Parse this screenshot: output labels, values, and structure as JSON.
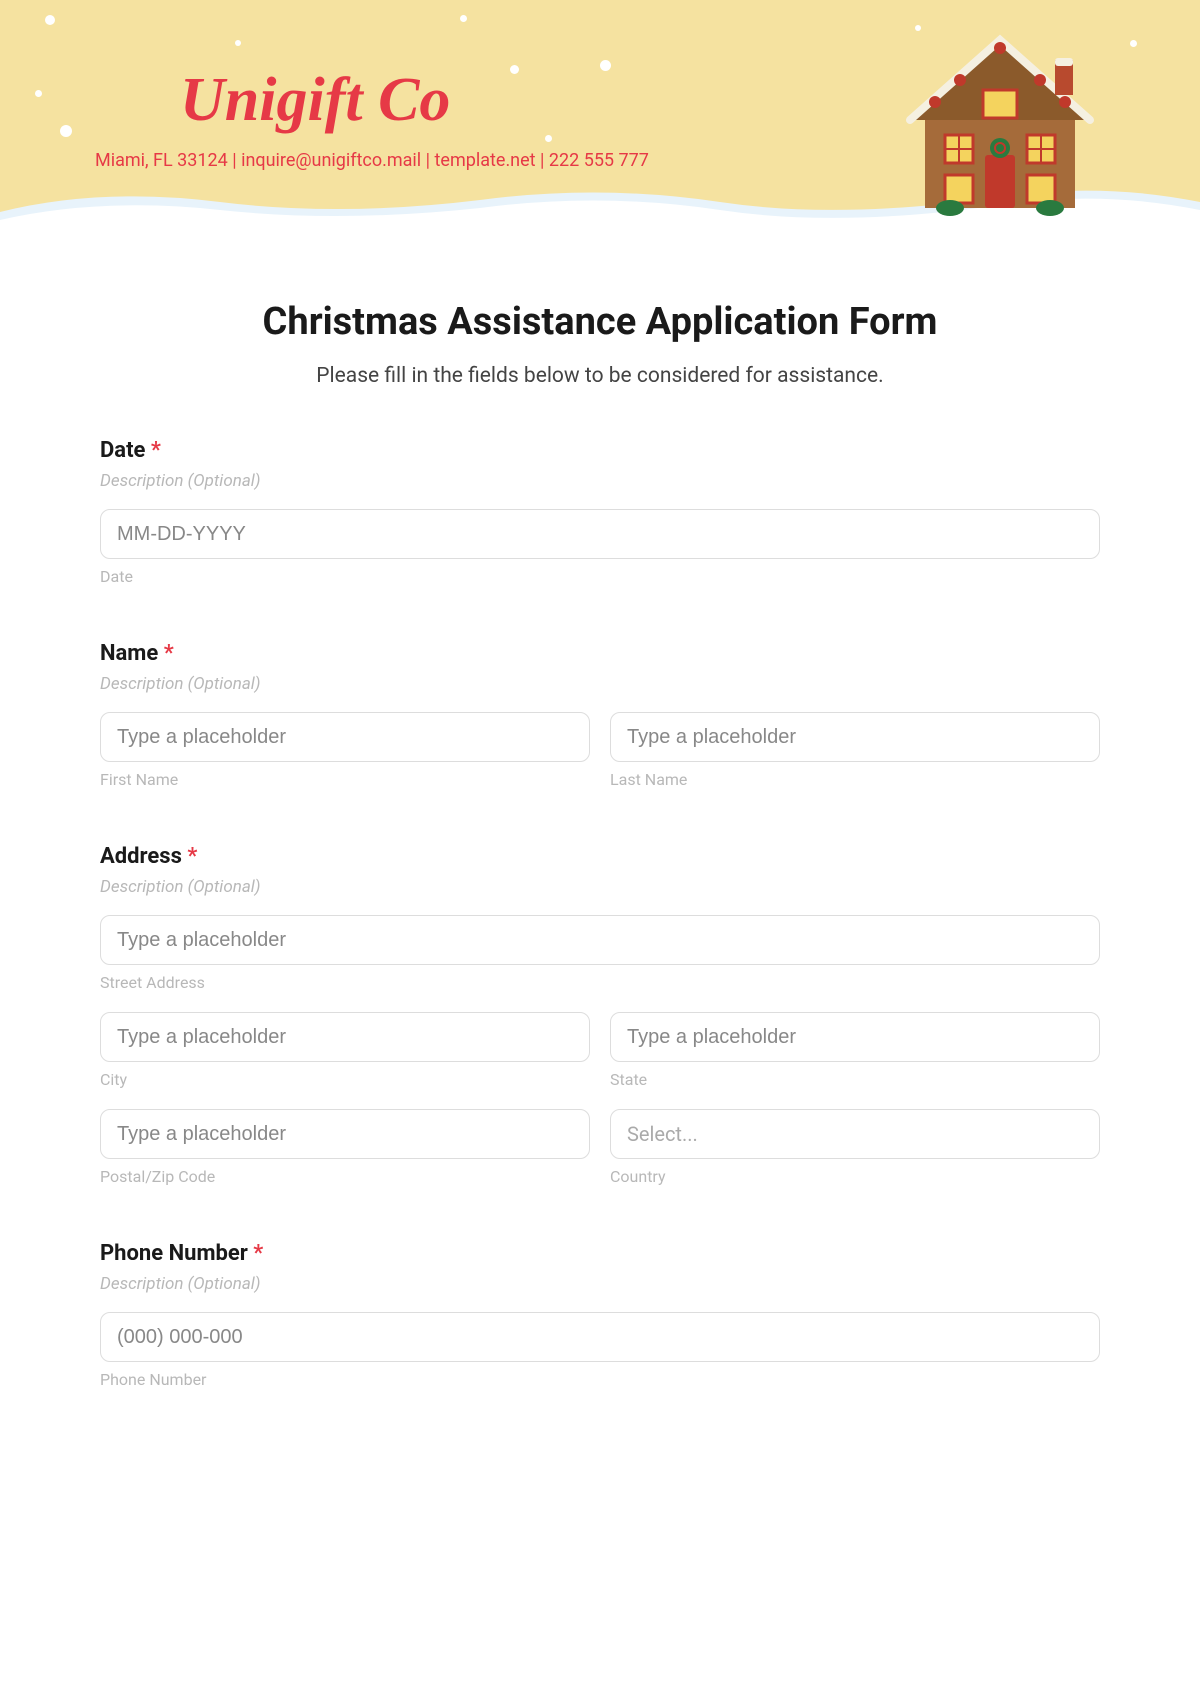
{
  "header": {
    "logo": "Unigift Co",
    "contact": "Miami, FL 33124 | inquire@unigiftco.mail | template.net | 222 555 777"
  },
  "form": {
    "title": "Christmas Assistance Application Form",
    "subtitle": "Please fill in the fields below to be considered for assistance.",
    "required_mark": "*",
    "desc_placeholder": "Description (Optional)",
    "date": {
      "label": "Date",
      "placeholder": "MM-DD-YYYY",
      "sublabel": "Date"
    },
    "name": {
      "label": "Name",
      "first_placeholder": "Type a placeholder",
      "first_sublabel": "First Name",
      "last_placeholder": "Type a placeholder",
      "last_sublabel": "Last Name"
    },
    "address": {
      "label": "Address",
      "street_placeholder": "Type a placeholder",
      "street_sublabel": "Street Address",
      "city_placeholder": "Type a placeholder",
      "city_sublabel": "City",
      "state_placeholder": "Type a placeholder",
      "state_sublabel": "State",
      "postal_placeholder": "Type a placeholder",
      "postal_sublabel": "Postal/Zip Code",
      "country_placeholder": "Select...",
      "country_sublabel": "Country"
    },
    "phone": {
      "label": "Phone Number",
      "placeholder": "(000) 000-000",
      "sublabel": "Phone Number"
    }
  }
}
